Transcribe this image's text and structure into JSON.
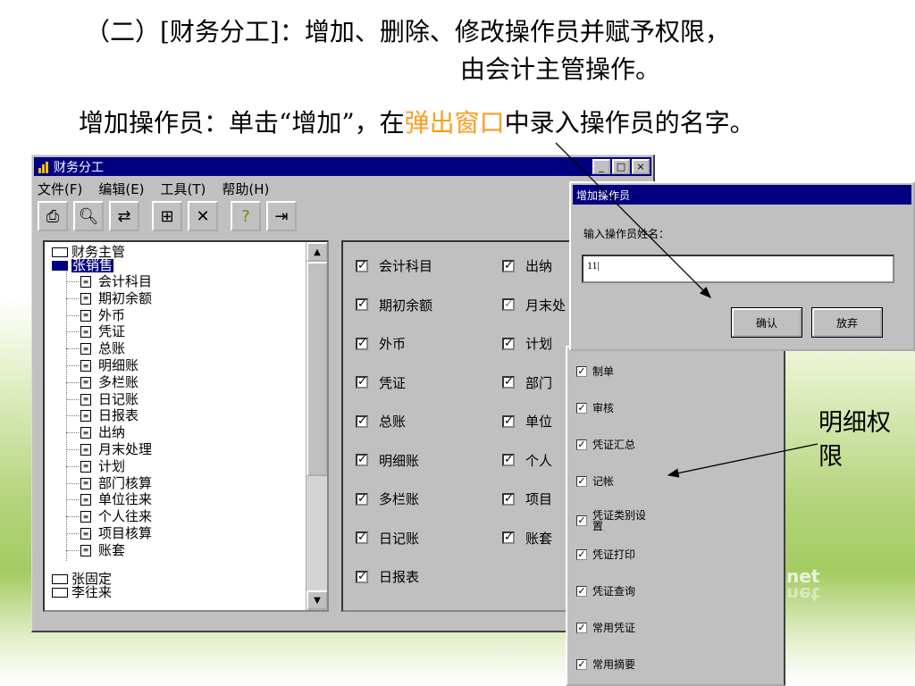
{
  "slide": {
    "title_line1": "（二）[财务分工]：增加、删除、修改操作员并赋予权限，",
    "title_line2": "由会计主管操作。",
    "instruction_before": "增加操作员：单击“增加”，在",
    "instruction_highlight": "弹出窗口",
    "instruction_after": "中录入操作员的名字。",
    "detail_label": "明细权限",
    "watermark": "net",
    "highlight_color": "#ff9c1a"
  },
  "main_window": {
    "title": "财务分工",
    "title_buttons": [
      "_",
      "□",
      "×"
    ],
    "menu": [
      "文件(F)",
      "编辑(E)",
      "工具(T)",
      "帮助(H)"
    ],
    "toolbar_icons": [
      "print-icon",
      "preview-icon",
      "export-icon",
      "add-icon",
      "delete-icon",
      "help-icon",
      "exit-icon"
    ],
    "tree": {
      "groups": [
        {
          "label": "财务主管",
          "open": false
        },
        {
          "label": "张销售",
          "open": true,
          "selected": true
        }
      ],
      "children": [
        "会计科目",
        "期初余额",
        "外币",
        "凭证",
        "总账",
        "明细账",
        "多栏账",
        "日记账",
        "日报表",
        "出纳",
        "月末处理",
        "计划",
        "部门核算",
        "单位往来",
        "个人往来",
        "项目核算",
        "账套"
      ],
      "trailing_groups": [
        "张固定",
        "李往来"
      ]
    },
    "permissions_col1": [
      "会计科目",
      "期初余额",
      "外币",
      "凭证",
      "总账",
      "明细账",
      "多栏账",
      "日记账",
      "日报表"
    ],
    "permissions_col2": [
      "出纳",
      "月末处",
      "计划",
      "部门",
      "单位",
      "个人",
      "项目",
      "账套"
    ]
  },
  "add_dialog": {
    "title": "增加操作员",
    "label": "输入操作员姓名：",
    "input_value": "11|",
    "confirm": "确认",
    "cancel": "放弃"
  },
  "detail_panel": {
    "items": [
      "制单",
      "审核",
      "凭证汇总",
      "记帐",
      "凭证类别设置",
      "凭证打印",
      "凭证查询",
      "常用凭证",
      "常用摘要"
    ]
  }
}
